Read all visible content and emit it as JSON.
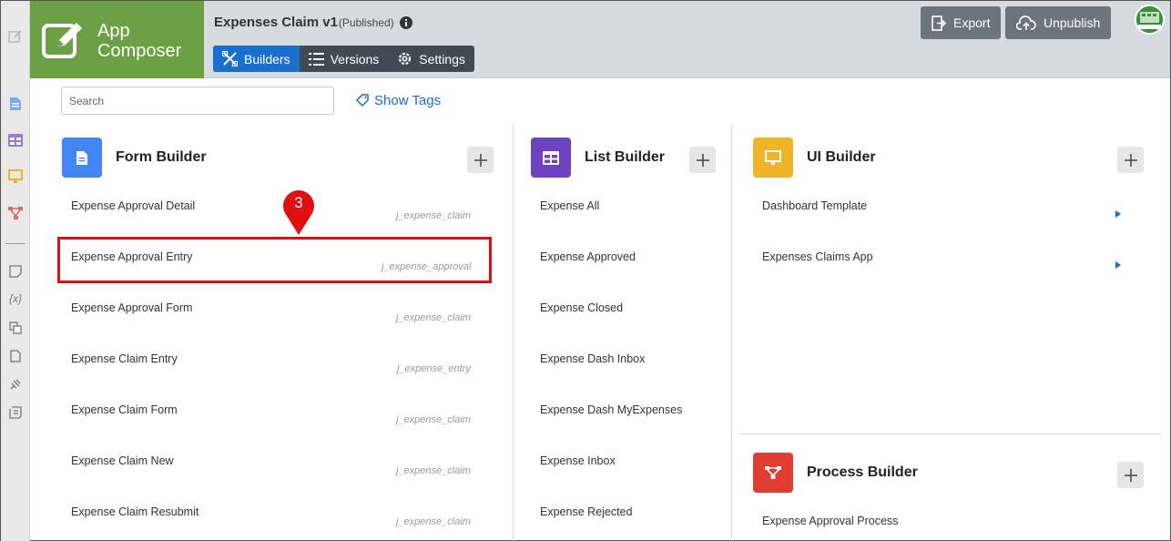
{
  "brand": {
    "line1": "App",
    "line2": "Composer"
  },
  "app": {
    "title": "Expenses Claim v1",
    "status": "(Published)"
  },
  "tabs": [
    {
      "label": "Builders",
      "icon": "tools-icon",
      "active": true
    },
    {
      "label": "Versions",
      "icon": "list-icon",
      "active": false
    },
    {
      "label": "Settings",
      "icon": "gear-icon",
      "active": false
    }
  ],
  "actions": {
    "export": "Export",
    "unpublish": "Unpublish"
  },
  "avatar": {
    "label": "admin"
  },
  "search": {
    "placeholder": "Search",
    "value": ""
  },
  "show_tags": "Show Tags",
  "form_builder": {
    "title": "Form Builder",
    "items": [
      {
        "label": "Expense Approval Detail",
        "tag": "j_expense_claim"
      },
      {
        "label": "Expense Approval Entry",
        "tag": "j_expense_approval"
      },
      {
        "label": "Expense Approval Form",
        "tag": "j_expense_claim"
      },
      {
        "label": "Expense Claim Entry",
        "tag": "j_expense_entry"
      },
      {
        "label": "Expense Claim Form",
        "tag": "j_expense_claim"
      },
      {
        "label": "Expense Claim New",
        "tag": "j_expense_claim"
      },
      {
        "label": "Expense Claim Resubmit",
        "tag": "j_expense_claim"
      }
    ]
  },
  "list_builder": {
    "title": "List Builder",
    "items": [
      "Expense All",
      "Expense Approved",
      "Expense Closed",
      "Expense Dash Inbox",
      "Expense Dash MyExpenses",
      "Expense Inbox",
      "Expense Rejected"
    ]
  },
  "ui_builder": {
    "title": "UI Builder",
    "items": [
      "Dashboard Template",
      "Expenses Claims App"
    ]
  },
  "process_builder": {
    "title": "Process Builder",
    "items": [
      "Expense Approval Process"
    ]
  },
  "annotation": {
    "step": "3"
  },
  "colors": {
    "brand": "#6ca044",
    "active_tab": "#1a6fcd",
    "form": "#4285f4",
    "list": "#6f42c1",
    "ui": "#f0b429",
    "process": "#e03c31",
    "highlight": "#e01010"
  }
}
